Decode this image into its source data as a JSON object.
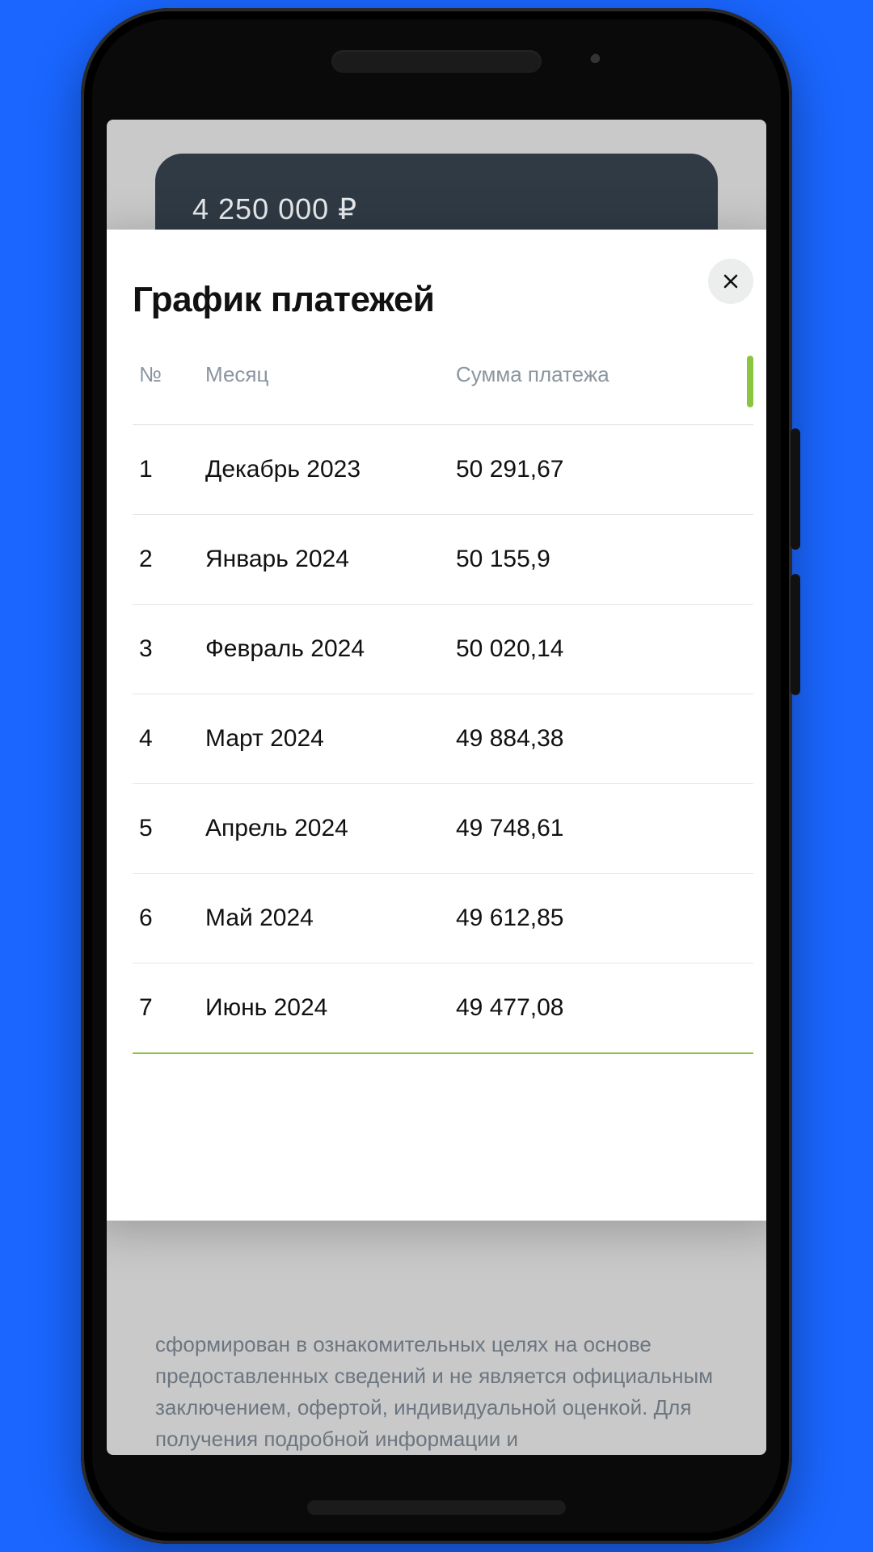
{
  "background": {
    "card_amount": "4 250 000 ₽",
    "disclaimer": "сформирован в ознакомительных целях на основе предоставленных сведений и не является официальным заключением, офертой, индивидуальной оценкой. Для получения подробной информации и"
  },
  "modal": {
    "title": "График платежей",
    "columns": {
      "num": "№",
      "month": "Месяц",
      "amount": "Сумма платежа"
    },
    "rows": [
      {
        "n": "1",
        "month": "Декабрь 2023",
        "amount": "50 291,67"
      },
      {
        "n": "2",
        "month": "Январь 2024",
        "amount": "50 155,9"
      },
      {
        "n": "3",
        "month": "Февраль 2024",
        "amount": "50 020,14"
      },
      {
        "n": "4",
        "month": "Март 2024",
        "amount": "49 884,38"
      },
      {
        "n": "5",
        "month": "Апрель 2024",
        "amount": "49 748,61"
      },
      {
        "n": "6",
        "month": "Май 2024",
        "amount": "49 612,85"
      },
      {
        "n": "7",
        "month": "Июнь 2024",
        "amount": "49 477,08"
      }
    ]
  }
}
